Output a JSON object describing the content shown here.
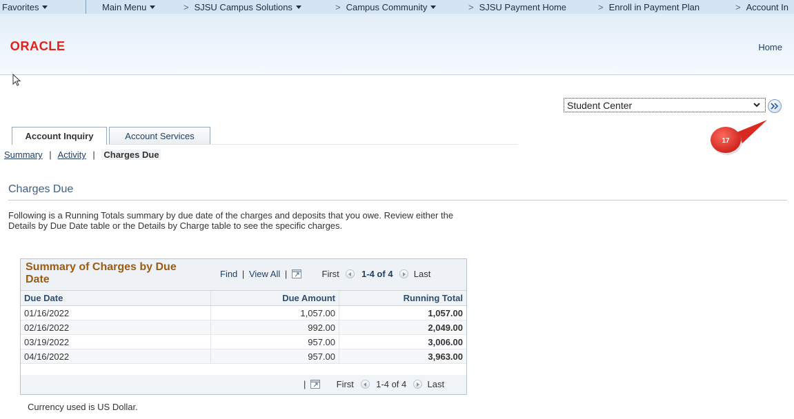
{
  "topnav": {
    "favorites": "Favorites",
    "main_menu": "Main Menu",
    "breadcrumbs": [
      "SJSU Campus Solutions",
      "Campus Community",
      "SJSU Payment Home",
      "Enroll in Payment Plan",
      "Account In"
    ],
    "arrow": ">"
  },
  "header": {
    "logo_text": "ORACLE",
    "home_link": "Home"
  },
  "navigator": {
    "selected": "Student Center"
  },
  "callout": {
    "number": "17"
  },
  "tabs": [
    {
      "label": "Account Inquiry"
    },
    {
      "label": "Account Services"
    }
  ],
  "subnav": {
    "summary": "Summary",
    "activity": "Activity",
    "current": "Charges Due",
    "sep": "|"
  },
  "page": {
    "title": "Charges Due",
    "description": "Following is a Running Totals summary by due date of the charges and deposits that you owe. Review either the Details by Due Date table or the Details by Charge table to see the specific charges."
  },
  "grid": {
    "title": "Summary of Charges by Due Date",
    "find": "Find",
    "view_all": "View All",
    "sep": "|",
    "first": "First",
    "range": "1-4 of 4",
    "last": "Last",
    "columns": [
      "Due Date",
      "Due Amount",
      "Running Total"
    ],
    "rows": [
      {
        "date": "01/16/2022",
        "amount": "1,057.00",
        "total": "1,057.00"
      },
      {
        "date": "02/16/2022",
        "amount": "992.00",
        "total": "2,049.00"
      },
      {
        "date": "03/19/2022",
        "amount": "957.00",
        "total": "3,006.00"
      },
      {
        "date": "04/16/2022",
        "amount": "957.00",
        "total": "3,963.00"
      }
    ]
  },
  "footer": {
    "currency_note": "Currency used is US Dollar."
  },
  "colors": {
    "nav_bg": "#d4e4f3",
    "oracle_red": "#e2231a",
    "grid_title": "#9a5c12",
    "callout": "#e0302b"
  }
}
